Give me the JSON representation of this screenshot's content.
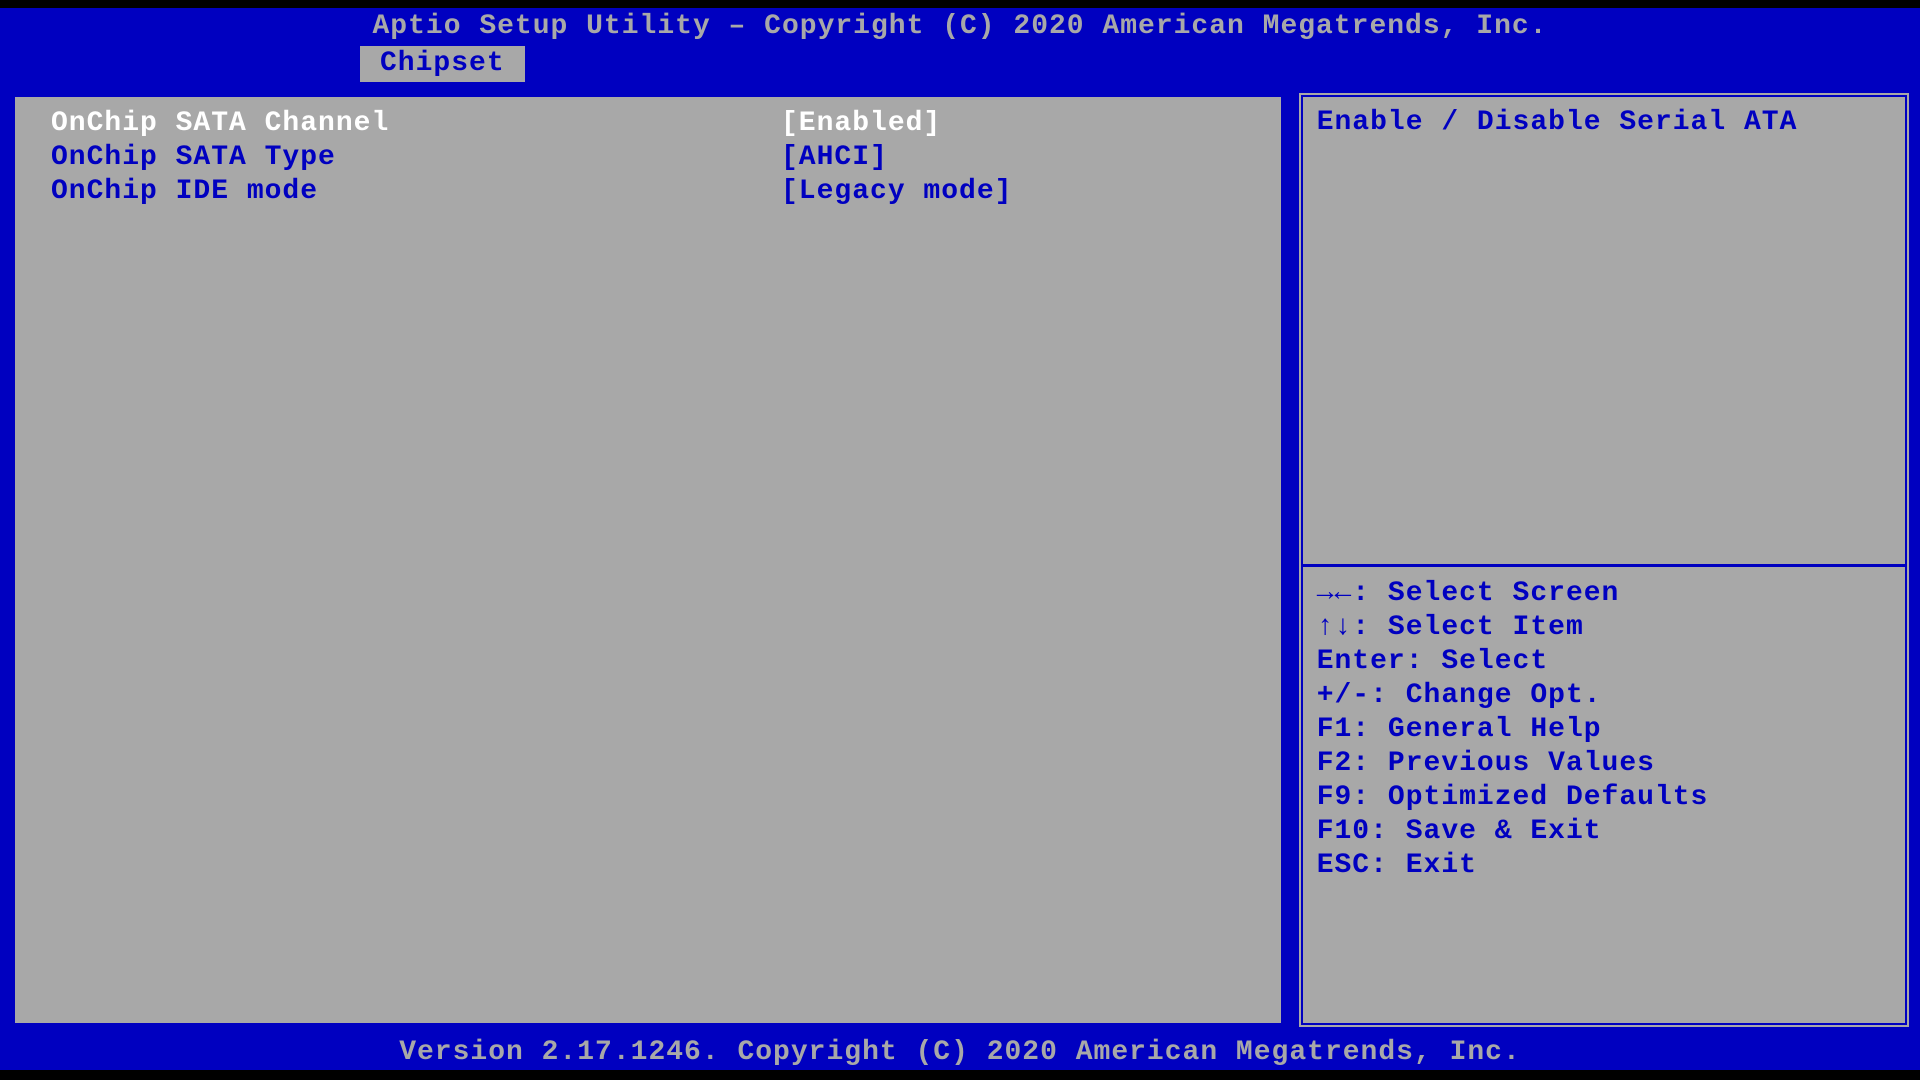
{
  "header": {
    "title": "Aptio Setup Utility – Copyright (C) 2020 American Megatrends, Inc."
  },
  "tabs": {
    "active": "Chipset"
  },
  "settings": [
    {
      "label": "OnChip SATA Channel",
      "value": "[Enabled]",
      "selected": true
    },
    {
      "label": "OnChip SATA Type",
      "value": "[AHCI]",
      "selected": false
    },
    {
      "label": "OnChip IDE mode",
      "value": "[Legacy mode]",
      "selected": false
    }
  ],
  "help": {
    "description": "Enable / Disable Serial ATA"
  },
  "nav": {
    "screen": "→←: Select Screen",
    "item": "↑↓: Select Item",
    "enter": "Enter: Select",
    "change": "+/-: Change Opt.",
    "f1": "F1: General Help",
    "f2": "F2: Previous Values",
    "f9": "F9: Optimized Defaults",
    "f10": "F10: Save & Exit",
    "esc": "ESC: Exit"
  },
  "footer": {
    "version": "Version 2.17.1246. Copyright (C) 2020 American Megatrends, Inc."
  }
}
